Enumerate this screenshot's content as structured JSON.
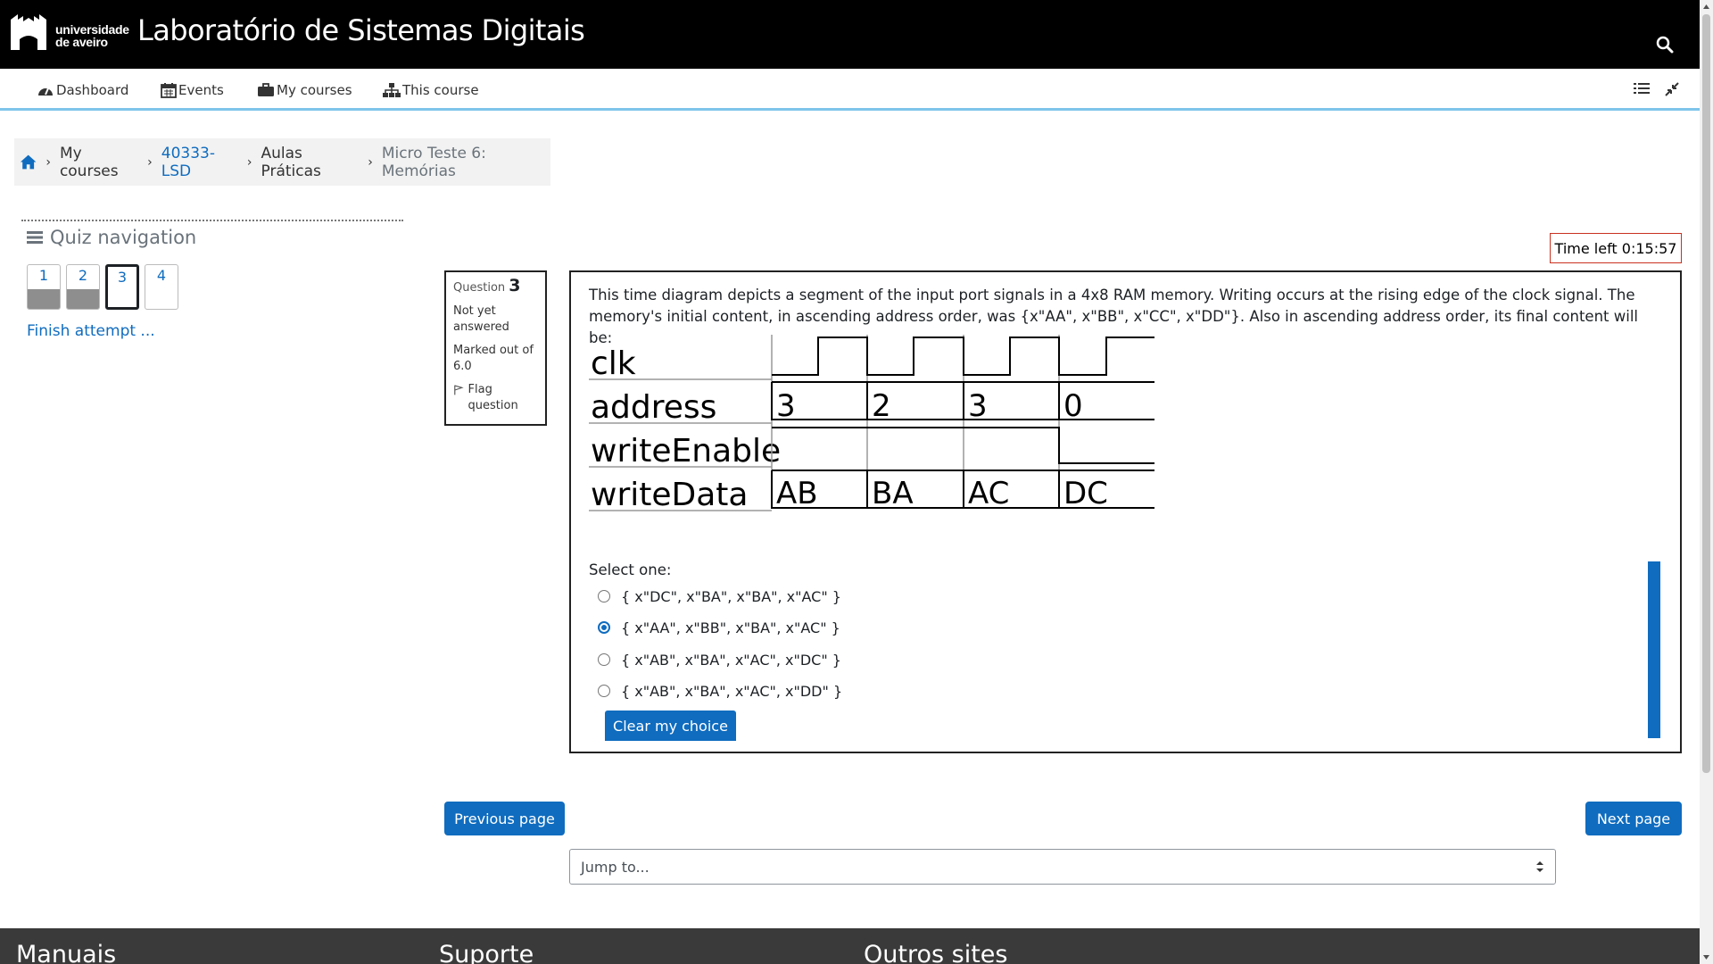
{
  "header": {
    "logo_text_line1": "universidade",
    "logo_text_line2": "de aveiro",
    "site_title": "Laboratório de Sistemas Digitais"
  },
  "nav": {
    "items": [
      {
        "label": "Dashboard",
        "icon": "dashboard-icon"
      },
      {
        "label": "Events",
        "icon": "calendar-icon"
      },
      {
        "label": "My courses",
        "icon": "briefcase-icon"
      },
      {
        "label": "This course",
        "icon": "sitemap-icon"
      }
    ]
  },
  "breadcrumb": {
    "items": [
      "My courses",
      "40333-LSD",
      "Aulas Práticas",
      "Micro Teste 6: Memórias"
    ]
  },
  "quiz_nav": {
    "title": "Quiz navigation",
    "questions": [
      "1",
      "2",
      "3",
      "4"
    ],
    "finish_link": "Finish attempt ..."
  },
  "timer": "Time left 0:15:57",
  "question_info": {
    "label": "Question",
    "number": "3",
    "state": "Not yet answered",
    "marks": "Marked out of 6.0",
    "flag": "Flag question"
  },
  "question": {
    "text": "This time diagram depicts a segment of the input port signals in a 4x8 RAM memory. Writing occurs at the rising edge of the clock signal. The memory's initial content, in ascending address order, was {x\"AA\", x\"BB\", x\"CC\", x\"DD\"}. Also in ascending address order, its final content will be:",
    "diagram": {
      "signals": [
        "clk",
        "address",
        "writeEnable",
        "writeData"
      ],
      "address_values": [
        "3",
        "2",
        "3",
        "0"
      ],
      "writedata_values": [
        "AB",
        "BA",
        "AC",
        "DC"
      ]
    },
    "select_one": "Select one:",
    "options": [
      "{ x\"DC\", x\"BA\", x\"BA\", x\"AC\" }",
      "{ x\"AA\", x\"BB\", x\"BA\", x\"AC\" }",
      "{ x\"AB\", x\"BA\", x\"AC\", x\"DC\" }",
      "{ x\"AB\", x\"BA\", x\"AC\", x\"DD\" }"
    ],
    "selected_option": 1,
    "clear_label": "Clear my choice"
  },
  "page_nav": {
    "previous": "Previous page",
    "next": "Next page",
    "jump_placeholder": "Jump to..."
  },
  "footer": {
    "columns": [
      "Manuais",
      "Suporte",
      "Outros sites"
    ]
  },
  "colors": {
    "primary": "#0f6cbf",
    "topbar": "#000000",
    "footer": "#3a3a3a",
    "timer_border": "#ca3120"
  }
}
